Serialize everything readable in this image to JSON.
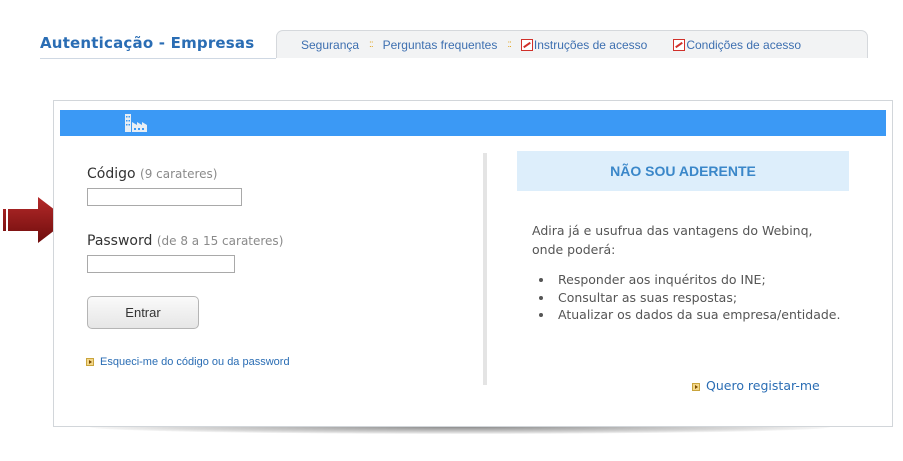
{
  "header": {
    "app_title": "Autenticação - Empresas",
    "nav": [
      {
        "label": "Segurança",
        "icon": null
      },
      {
        "label": "Perguntas frequentes",
        "icon": null
      },
      {
        "label": "Instruções de acesso",
        "icon": "pdf-icon"
      },
      {
        "label": "Condições de acesso",
        "icon": "pdf-icon"
      }
    ],
    "separator": "::"
  },
  "login": {
    "banner_icon": "factory-icon",
    "code_label": "Código",
    "code_hint": "(9 carateres)",
    "code_value": "",
    "password_label": "Password",
    "password_hint": "(de 8 a 15 carateres)",
    "password_value": "",
    "submit_label": "Entrar",
    "forgot_link": "Esqueci-me do código ou da password"
  },
  "signup": {
    "heading": "NÃO SOU ADERENTE",
    "intro": "Adira já e usufrua das vantagens do Webinq, onde poderá:",
    "benefits": [
      "Responder aos inquéritos do INE;",
      "Consultar as suas respostas;",
      "Atualizar os dados da sua empresa/entidade."
    ],
    "register_link": "Quero registar-me"
  },
  "colors": {
    "accent_blue": "#3b99f5",
    "title_blue": "#2a6db4",
    "heading_bg": "#ddeefb",
    "arrow_red": "#8b1414"
  }
}
